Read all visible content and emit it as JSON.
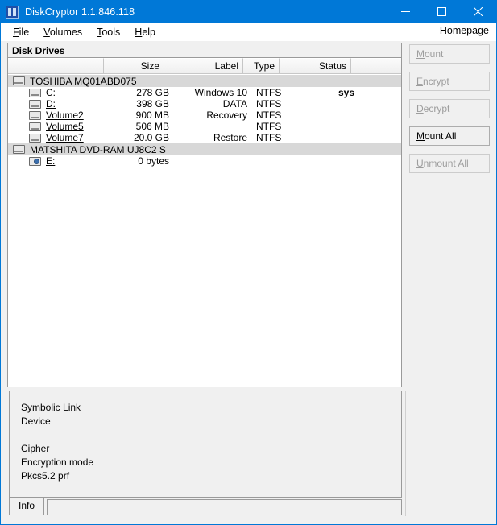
{
  "window": {
    "title": "DiskCryptor 1.1.846.118",
    "app_icon": "diskcryptor-icon",
    "minimize_label": "Minimize",
    "maximize_label": "Maximize",
    "close_label": "Close"
  },
  "menubar": {
    "items": [
      {
        "label": "File",
        "accel": "F",
        "rest": "ile"
      },
      {
        "label": "Volumes",
        "accel": "V",
        "rest": "olumes"
      },
      {
        "label": "Tools",
        "accel": "T",
        "rest": "ools"
      },
      {
        "label": "Help",
        "accel": "H",
        "rest": "elp"
      }
    ],
    "homepage": {
      "pre": "Homep",
      "accel": "a",
      "post": "ge"
    }
  },
  "group": {
    "caption": "Disk Drives"
  },
  "list": {
    "columns": [
      {
        "key": "name",
        "label": ""
      },
      {
        "key": "size",
        "label": "Size"
      },
      {
        "key": "label",
        "label": "Label"
      },
      {
        "key": "type",
        "label": "Type"
      },
      {
        "key": "status",
        "label": "Status"
      }
    ],
    "rows": [
      {
        "kind": "disk",
        "icon": "hard-disk-icon",
        "name": "TOSHIBA MQ01ABD075",
        "size": "",
        "label": "",
        "type": "",
        "status": ""
      },
      {
        "kind": "vol",
        "icon": "hard-disk-icon",
        "name": "C:",
        "size": "278 GB",
        "label": "Windows 10",
        "type": "NTFS",
        "status": "sys"
      },
      {
        "kind": "vol",
        "icon": "hard-disk-icon",
        "name": "D:",
        "size": "398 GB",
        "label": "DATA",
        "type": "NTFS",
        "status": ""
      },
      {
        "kind": "vol",
        "icon": "hard-disk-icon",
        "name": "Volume2",
        "size": "900 MB",
        "label": "Recovery",
        "type": "NTFS",
        "status": ""
      },
      {
        "kind": "vol",
        "icon": "hard-disk-icon",
        "name": "Volume5",
        "size": "506 MB",
        "label": "",
        "type": "NTFS",
        "status": ""
      },
      {
        "kind": "vol",
        "icon": "hard-disk-icon",
        "name": "Volume7",
        "size": "20.0 GB",
        "label": "Restore",
        "type": "NTFS",
        "status": ""
      },
      {
        "kind": "disk",
        "icon": "hard-disk-icon",
        "name": "MATSHITA DVD-RAM UJ8C2 S",
        "size": "",
        "label": "",
        "type": "",
        "status": ""
      },
      {
        "kind": "vol",
        "icon": "cdrom-icon",
        "name": "E:",
        "size": "0 bytes",
        "label": "",
        "type": "",
        "status": ""
      }
    ]
  },
  "buttons": [
    {
      "name": "mount-button",
      "accel": "M",
      "rest": "ount",
      "enabled": false
    },
    {
      "name": "encrypt-button",
      "accel": "E",
      "rest": "ncrypt",
      "enabled": false
    },
    {
      "name": "decrypt-button",
      "accel": "D",
      "rest": "ecrypt",
      "enabled": false
    },
    {
      "name": "mount-all-button",
      "accel": "M",
      "rest": "ount All",
      "enabled": true
    },
    {
      "name": "unmount-all-button",
      "accel": "U",
      "rest": "nmount All",
      "enabled": false
    }
  ],
  "info": {
    "lines": [
      {
        "label": "Symbolic Link",
        "value": ""
      },
      {
        "label": "Device",
        "value": ""
      },
      {
        "label": "",
        "value": ""
      },
      {
        "label": "Cipher",
        "value": ""
      },
      {
        "label": "Encryption mode",
        "value": ""
      },
      {
        "label": "Pkcs5.2 prf",
        "value": ""
      }
    ]
  },
  "tabs": [
    {
      "label": "Info",
      "selected": true
    }
  ],
  "colors": {
    "titlebar": "#0078d7",
    "window_bg": "#f0f0f0",
    "list_bg": "#ffffff",
    "disk_row_bg": "#d8d8d8",
    "disabled_text": "#9d9d9d"
  }
}
